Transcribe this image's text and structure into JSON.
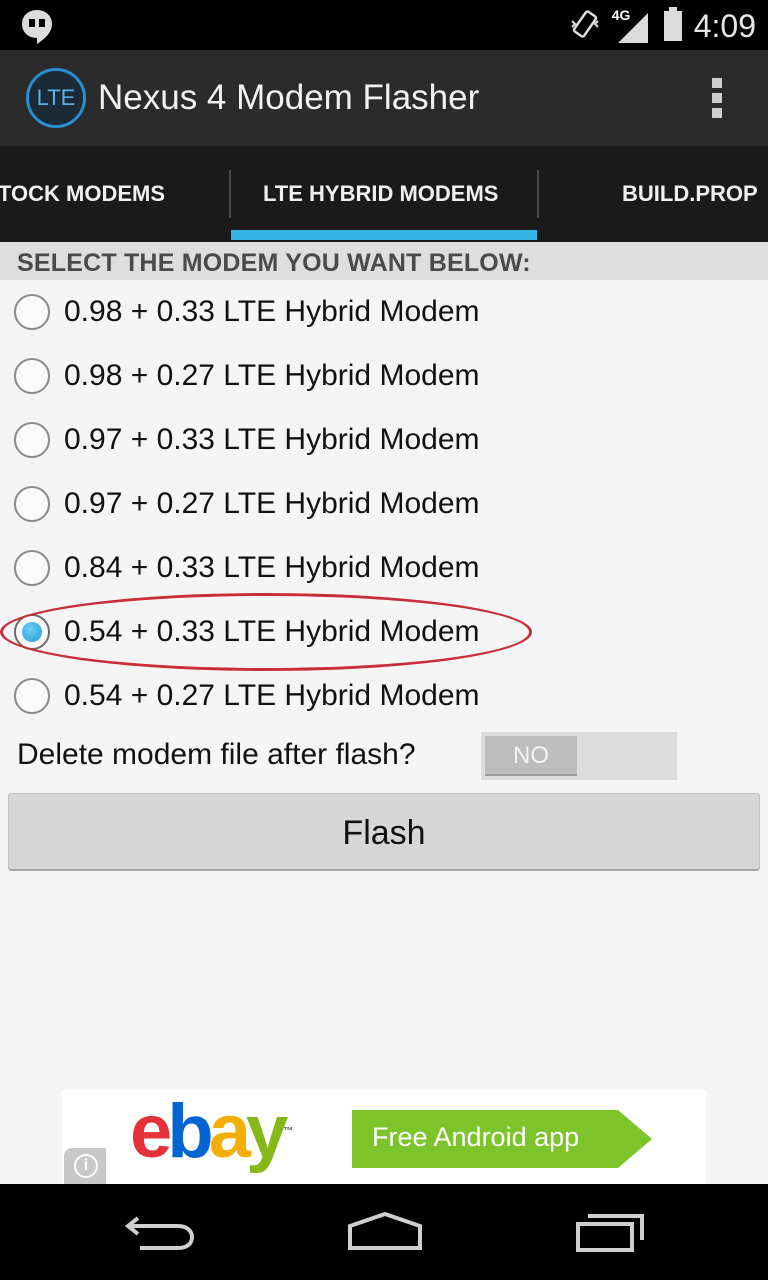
{
  "status_bar": {
    "time": "4:09",
    "network": "4G",
    "icons": [
      "hangouts-icon",
      "vibrate-icon",
      "signal-icon",
      "battery-icon"
    ]
  },
  "action_bar": {
    "app_icon_text": "LTE",
    "title": "Nexus 4 Modem Flasher",
    "overflow_icon": "overflow-menu-icon"
  },
  "tabs": [
    {
      "label": "TOCK MODEMS",
      "selected": false
    },
    {
      "label": "LTE HYBRID MODEMS",
      "selected": true
    },
    {
      "label": "BUILD.PROP",
      "selected": false
    }
  ],
  "main": {
    "section_header": "SELECT THE MODEM YOU WANT BELOW:",
    "modems": [
      {
        "label": "0.98 + 0.33 LTE Hybrid Modem",
        "checked": false
      },
      {
        "label": "0.98 + 0.27 LTE Hybrid Modem",
        "checked": false
      },
      {
        "label": "0.97 + 0.33 LTE Hybrid Modem",
        "checked": false
      },
      {
        "label": "0.97 + 0.27 LTE Hybrid Modem",
        "checked": false
      },
      {
        "label": "0.84 + 0.33 LTE Hybrid Modem",
        "checked": false
      },
      {
        "label": "0.54 + 0.33 LTE Hybrid Modem",
        "checked": true
      },
      {
        "label": "0.54 + 0.27 LTE Hybrid Modem",
        "checked": false
      }
    ],
    "delete_label": "Delete modem file after flash?",
    "toggle_value": "NO",
    "flash_label": "Flash"
  },
  "ad": {
    "brand": "ebay",
    "cta": "Free Android app",
    "info_icon": "info-icon",
    "colors": {
      "e": "#e53238",
      "b": "#0064d2",
      "a": "#f5af02",
      "y": "#86b817",
      "cta_bg": "#7dc42a"
    }
  },
  "colors": {
    "accent": "#33b5e5",
    "action_bar": "#2b2b2b",
    "tab_bar": "#1a1a1a",
    "highlight": "#c82d3a"
  },
  "nav_bar": {
    "icons": [
      "back-icon",
      "home-icon",
      "recents-icon"
    ]
  }
}
